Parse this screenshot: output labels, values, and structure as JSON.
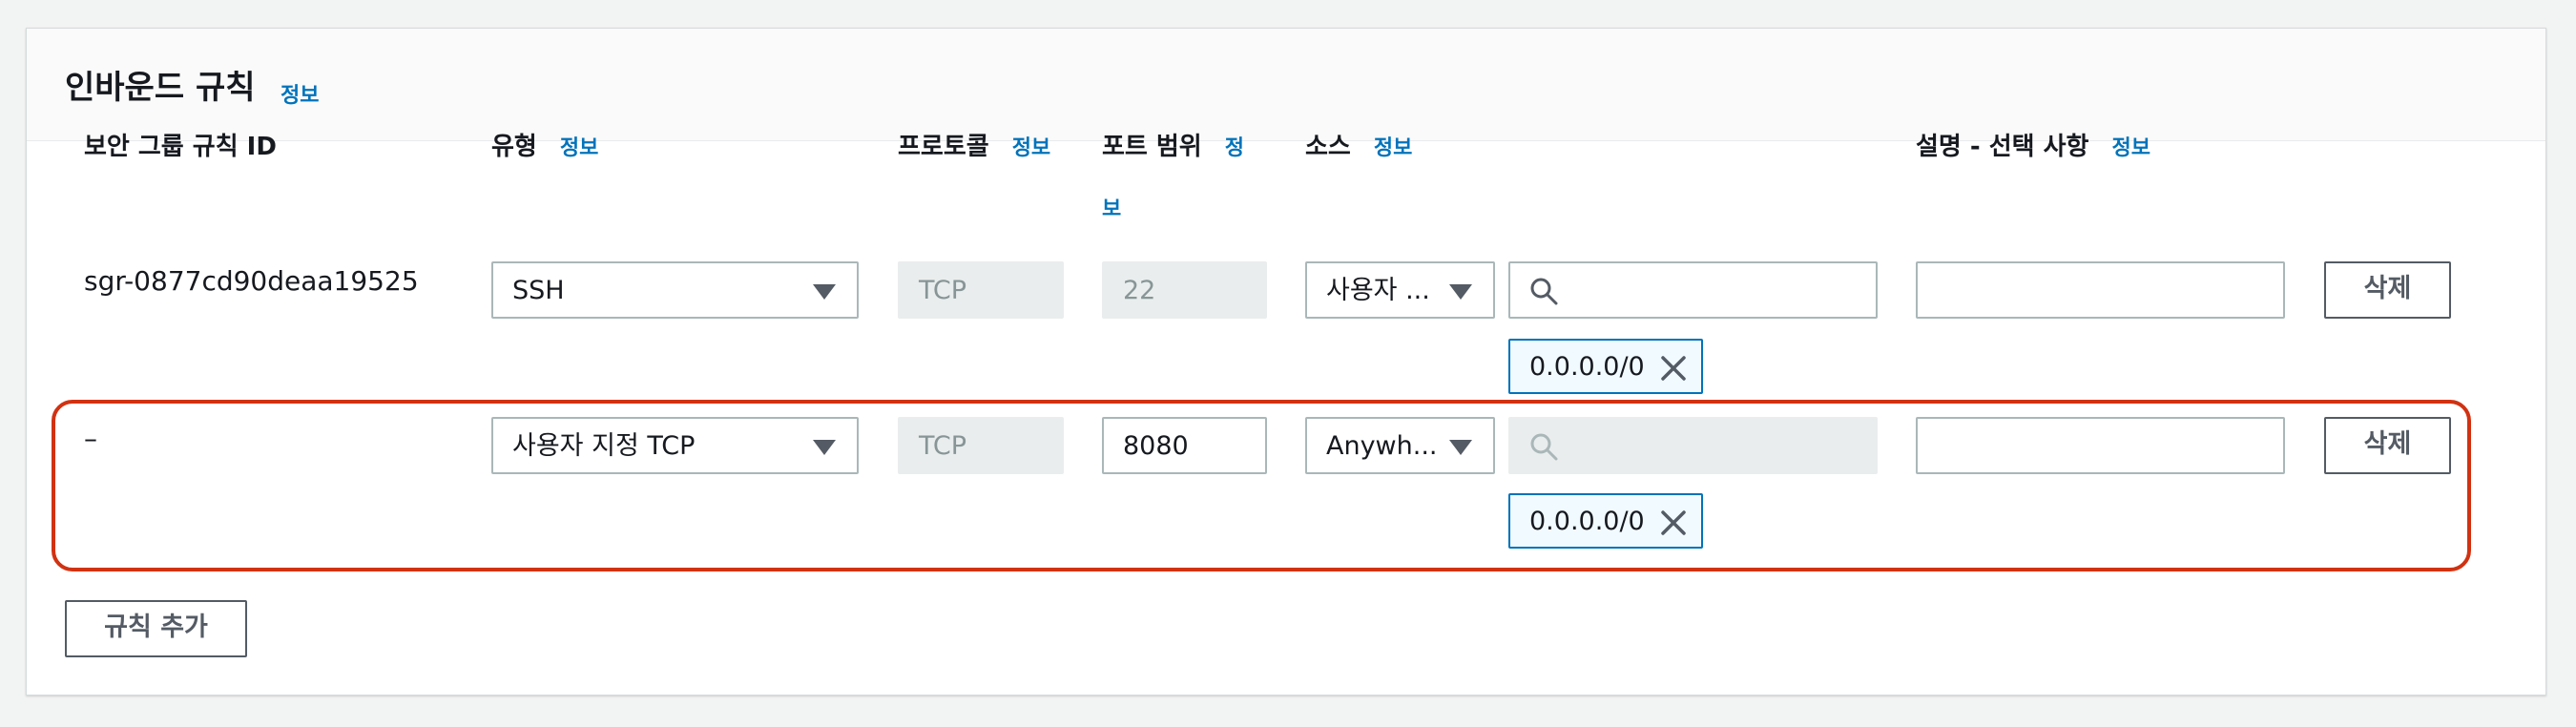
{
  "panel": {
    "title": "인바운드 규칙",
    "title_info": "정보"
  },
  "columns": {
    "rule_id": "보안 그룹 규칙 ID",
    "type": "유형",
    "type_info": "정보",
    "protocol": "프로토콜",
    "protocol_info": "정보",
    "port_range": "포트 범위",
    "port_info_line1": "정",
    "port_info_line2": "보",
    "source": "소스",
    "source_info": "정보",
    "description": "설명 - 선택 사항",
    "description_info": "정보"
  },
  "rules": [
    {
      "rule_id": "sgr-0877cd90deaa19525",
      "type": "SSH",
      "protocol": "TCP",
      "port_range": "22",
      "source_type": "사용자 ...",
      "source_search": "",
      "source_token": "0.0.0.0/0",
      "description": "",
      "delete_label": "삭제"
    },
    {
      "rule_id": "–",
      "type": "사용자 지정 TCP",
      "protocol": "TCP",
      "port_range": "8080",
      "source_type": "Anywh...",
      "source_search": "",
      "source_token": "0.0.0.0/0",
      "description": "",
      "delete_label": "삭제"
    }
  ],
  "add_rule_label": "규칙 추가",
  "colors": {
    "link": "#0073bb",
    "highlight": "#d13212",
    "token_border": "#0073bb",
    "token_bg": "#f1faff"
  }
}
